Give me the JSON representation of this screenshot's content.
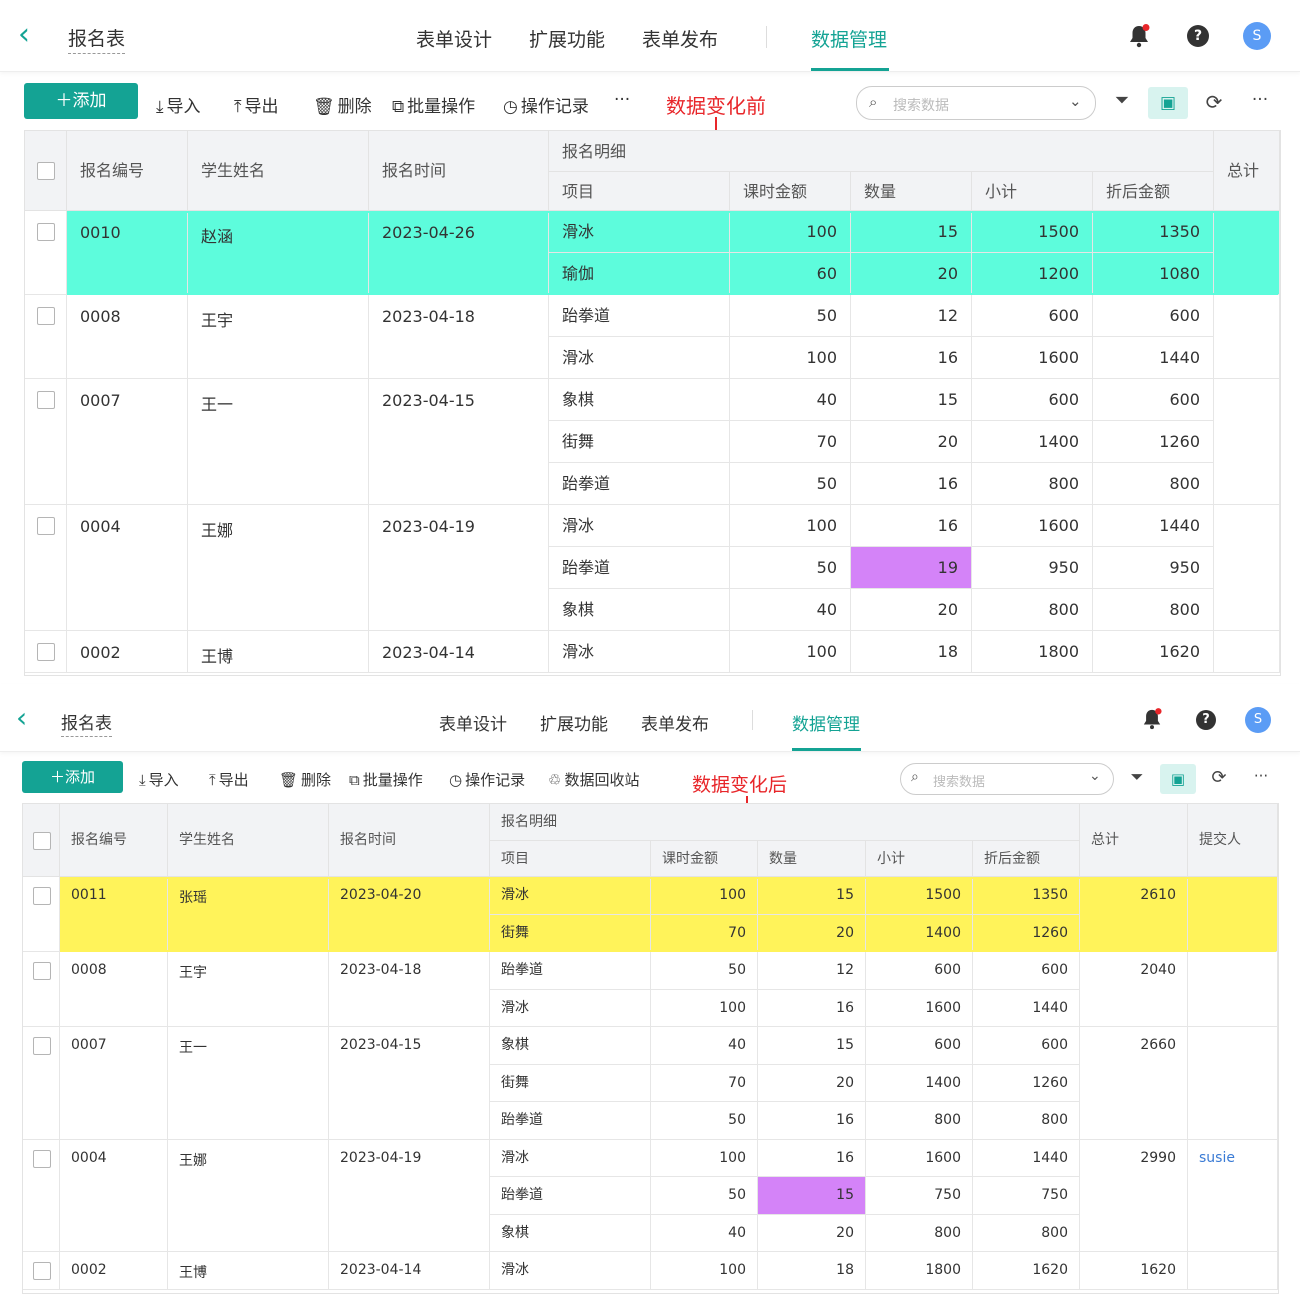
{
  "colors": {
    "accent": "#14a394",
    "highlight_before": "#5dfcdc",
    "highlight_after": "#fff35a",
    "changed_cell": "#d483f8",
    "annotation": "#e8262a"
  },
  "app": {
    "back_icon": "chevron-left-icon",
    "title": "报名表",
    "nav": [
      "表单设计",
      "扩展功能",
      "表单发布",
      "数据管理"
    ],
    "active_nav": "数据管理",
    "avatar": "S"
  },
  "toolbar_before": {
    "add": "添加",
    "import": "导入",
    "export": "导出",
    "delete": "删除",
    "batch": "批量操作",
    "log": "操作记录",
    "more": "···",
    "search_placeholder": "搜索数据"
  },
  "toolbar_after": {
    "add": "添加",
    "import": "导入",
    "export": "导出",
    "delete": "删除",
    "batch": "批量操作",
    "log": "操作记录",
    "recycle": "数据回收站",
    "more": "···",
    "search_placeholder": "搜索数据"
  },
  "annotation_before": "数据变化前",
  "annotation_after": "数据变化后",
  "headers": {
    "id": "报名编号",
    "name": "学生姓名",
    "time": "报名时间",
    "detail": "报名明细",
    "item": "项目",
    "price": "课时金额",
    "qty": "数量",
    "subtotal": "小计",
    "discount": "折后金额",
    "total": "总计",
    "submitter": "提交人"
  },
  "table_before": [
    {
      "id": "0010",
      "name": "赵涵",
      "time": "2023-04-26",
      "total": "",
      "submitter": "",
      "items": [
        [
          "滑冰",
          "100",
          "15",
          "1500",
          "1350"
        ],
        [
          "瑜伽",
          "60",
          "20",
          "1200",
          "1080"
        ]
      ]
    },
    {
      "id": "0008",
      "name": "王宇",
      "time": "2023-04-18",
      "total": "",
      "submitter": "",
      "items": [
        [
          "跆拳道",
          "50",
          "12",
          "600",
          "600"
        ],
        [
          "滑冰",
          "100",
          "16",
          "1600",
          "1440"
        ]
      ]
    },
    {
      "id": "0007",
      "name": "王一",
      "time": "2023-04-15",
      "total": "",
      "submitter": "",
      "items": [
        [
          "象棋",
          "40",
          "15",
          "600",
          "600"
        ],
        [
          "街舞",
          "70",
          "20",
          "1400",
          "1260"
        ],
        [
          "跆拳道",
          "50",
          "16",
          "800",
          "800"
        ]
      ]
    },
    {
      "id": "0004",
      "name": "王娜",
      "time": "2023-04-19",
      "total": "",
      "submitter": "",
      "items": [
        [
          "滑冰",
          "100",
          "16",
          "1600",
          "1440"
        ],
        [
          "跆拳道",
          "50",
          "19",
          "950",
          "950"
        ],
        [
          "象棋",
          "40",
          "20",
          "800",
          "800"
        ]
      ]
    },
    {
      "id": "0002",
      "name": "王博",
      "time": "2023-04-14",
      "total": "",
      "submitter": "",
      "items": [
        [
          "滑冰",
          "100",
          "18",
          "1800",
          "1620"
        ]
      ]
    }
  ],
  "table_after": [
    {
      "id": "0011",
      "name": "张瑶",
      "time": "2023-04-20",
      "total": "2610",
      "submitter": "",
      "items": [
        [
          "滑冰",
          "100",
          "15",
          "1500",
          "1350"
        ],
        [
          "街舞",
          "70",
          "20",
          "1400",
          "1260"
        ]
      ]
    },
    {
      "id": "0008",
      "name": "王宇",
      "time": "2023-04-18",
      "total": "2040",
      "submitter": "",
      "items": [
        [
          "跆拳道",
          "50",
          "12",
          "600",
          "600"
        ],
        [
          "滑冰",
          "100",
          "16",
          "1600",
          "1440"
        ]
      ]
    },
    {
      "id": "0007",
      "name": "王一",
      "time": "2023-04-15",
      "total": "2660",
      "submitter": "",
      "items": [
        [
          "象棋",
          "40",
          "15",
          "600",
          "600"
        ],
        [
          "街舞",
          "70",
          "20",
          "1400",
          "1260"
        ],
        [
          "跆拳道",
          "50",
          "16",
          "800",
          "800"
        ]
      ]
    },
    {
      "id": "0004",
      "name": "王娜",
      "time": "2023-04-19",
      "total": "2990",
      "submitter": "susie",
      "items": [
        [
          "滑冰",
          "100",
          "16",
          "1600",
          "1440"
        ],
        [
          "跆拳道",
          "50",
          "15",
          "750",
          "750"
        ],
        [
          "象棋",
          "40",
          "20",
          "800",
          "800"
        ]
      ]
    },
    {
      "id": "0002",
      "name": "王博",
      "time": "2023-04-14",
      "total": "1620",
      "submitter": "",
      "items": [
        [
          "滑冰",
          "100",
          "18",
          "1800",
          "1620"
        ]
      ]
    }
  ],
  "highlight": {
    "record_index": 0,
    "changed_record_index": 3,
    "changed_item_index": 1,
    "changed_field": "qty"
  }
}
